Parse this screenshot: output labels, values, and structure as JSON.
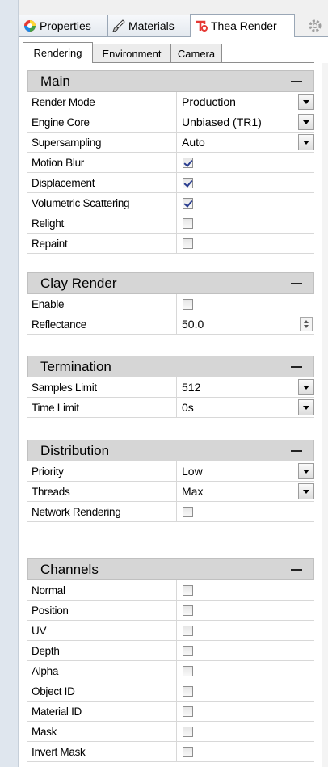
{
  "top_tabs": [
    {
      "label": "Properties",
      "icon": "color-wheel-icon"
    },
    {
      "label": "Materials",
      "icon": "brush-icon"
    },
    {
      "label": "Thea Render",
      "icon": "thea-logo-icon"
    }
  ],
  "sub_tabs": [
    "Rendering",
    "Environment",
    "Camera"
  ],
  "sections": {
    "main": {
      "title": "Main",
      "render_mode": {
        "label": "Render Mode",
        "value": "Production"
      },
      "engine_core": {
        "label": "Engine Core",
        "value": "Unbiased (TR1)"
      },
      "supersampling": {
        "label": "Supersampling",
        "value": "Auto"
      },
      "motion_blur": {
        "label": "Motion Blur",
        "checked": true
      },
      "displacement": {
        "label": "Displacement",
        "checked": true
      },
      "volumetric": {
        "label": "Volumetric Scattering",
        "checked": true
      },
      "relight": {
        "label": "Relight",
        "checked": false
      },
      "repaint": {
        "label": "Repaint",
        "checked": false
      }
    },
    "clay": {
      "title": "Clay Render",
      "enable": {
        "label": "Enable",
        "checked": false
      },
      "reflectance": {
        "label": "Reflectance",
        "value": "50.0"
      }
    },
    "termination": {
      "title": "Termination",
      "samples": {
        "label": "Samples Limit",
        "value": "512"
      },
      "time": {
        "label": "Time Limit",
        "value": "0s"
      }
    },
    "distribution": {
      "title": "Distribution",
      "priority": {
        "label": "Priority",
        "value": "Low"
      },
      "threads": {
        "label": "Threads",
        "value": "Max"
      },
      "network": {
        "label": "Network Rendering",
        "checked": false
      }
    },
    "channels": {
      "title": "Channels",
      "normal": {
        "label": "Normal",
        "checked": false
      },
      "position": {
        "label": "Position",
        "checked": false
      },
      "uv": {
        "label": "UV",
        "checked": false
      },
      "depth": {
        "label": "Depth",
        "checked": false
      },
      "alpha": {
        "label": "Alpha",
        "checked": false
      },
      "object_id": {
        "label": "Object ID",
        "checked": false
      },
      "material_id": {
        "label": "Material ID",
        "checked": false
      },
      "mask": {
        "label": "Mask",
        "checked": false
      },
      "invert_mask": {
        "label": "Invert Mask",
        "checked": false
      }
    }
  }
}
